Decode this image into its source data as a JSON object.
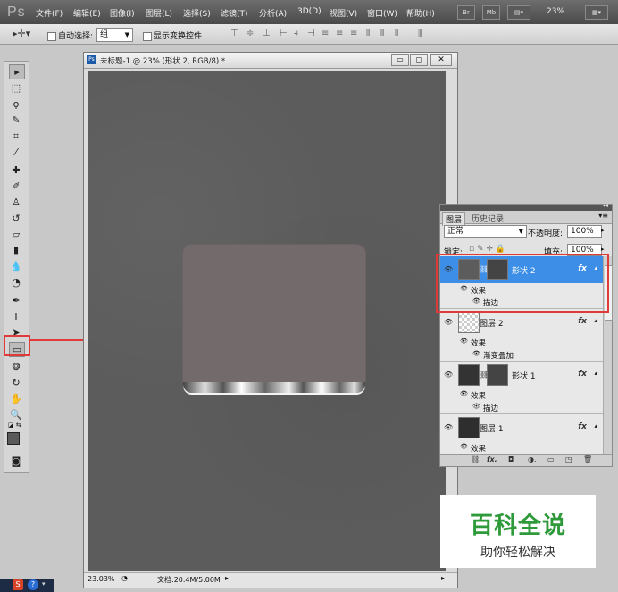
{
  "app": {
    "logo": "Ps"
  },
  "menu": [
    "文件(F)",
    "编辑(E)",
    "图像(I)",
    "图层(L)",
    "选择(S)",
    "滤镜(T)",
    "分析(A)",
    "3D(D)",
    "视图(V)",
    "窗口(W)",
    "帮助(H)"
  ],
  "menubar_buttons": {
    "br": "Br",
    "mb": "Mb"
  },
  "zoom": "23%",
  "options": {
    "auto_select_label": "自动选择:",
    "auto_select_value": "组",
    "show_transform_label": "显示变换控件"
  },
  "document": {
    "title": "未标题-1 @ 23% (形状 2, RGB/8) *",
    "zoom_status": "23.03%",
    "doc_size": "文档:20.4M/5.00M"
  },
  "layers_panel": {
    "tabs": [
      "图层",
      "历史记录"
    ],
    "blend_mode": "正常",
    "opacity_label": "不透明度:",
    "opacity_value": "100%",
    "lock_label": "锁定:",
    "fill_label": "填充:",
    "fill_value": "100%",
    "fx_label": "fx",
    "effects_label": "效果",
    "layers": [
      {
        "name": "形状 2",
        "selected": true,
        "effects": [
          "描边"
        ]
      },
      {
        "name": "图层 2",
        "selected": false,
        "effects": [
          "渐变叠加"
        ]
      },
      {
        "name": "形状 1",
        "selected": false,
        "effects": [
          "描边"
        ]
      },
      {
        "name": "图层 1",
        "selected": false,
        "effects": []
      }
    ]
  },
  "watermark": {
    "title": "百科全说",
    "subtitle": "助你轻松解决"
  },
  "colors": {
    "selected_row": "#3d8ee6",
    "annotation": "#e03a3a",
    "canvas": "#5c5c5c",
    "shape": "#726a6b",
    "watermark_green": "#2e9a3a"
  }
}
